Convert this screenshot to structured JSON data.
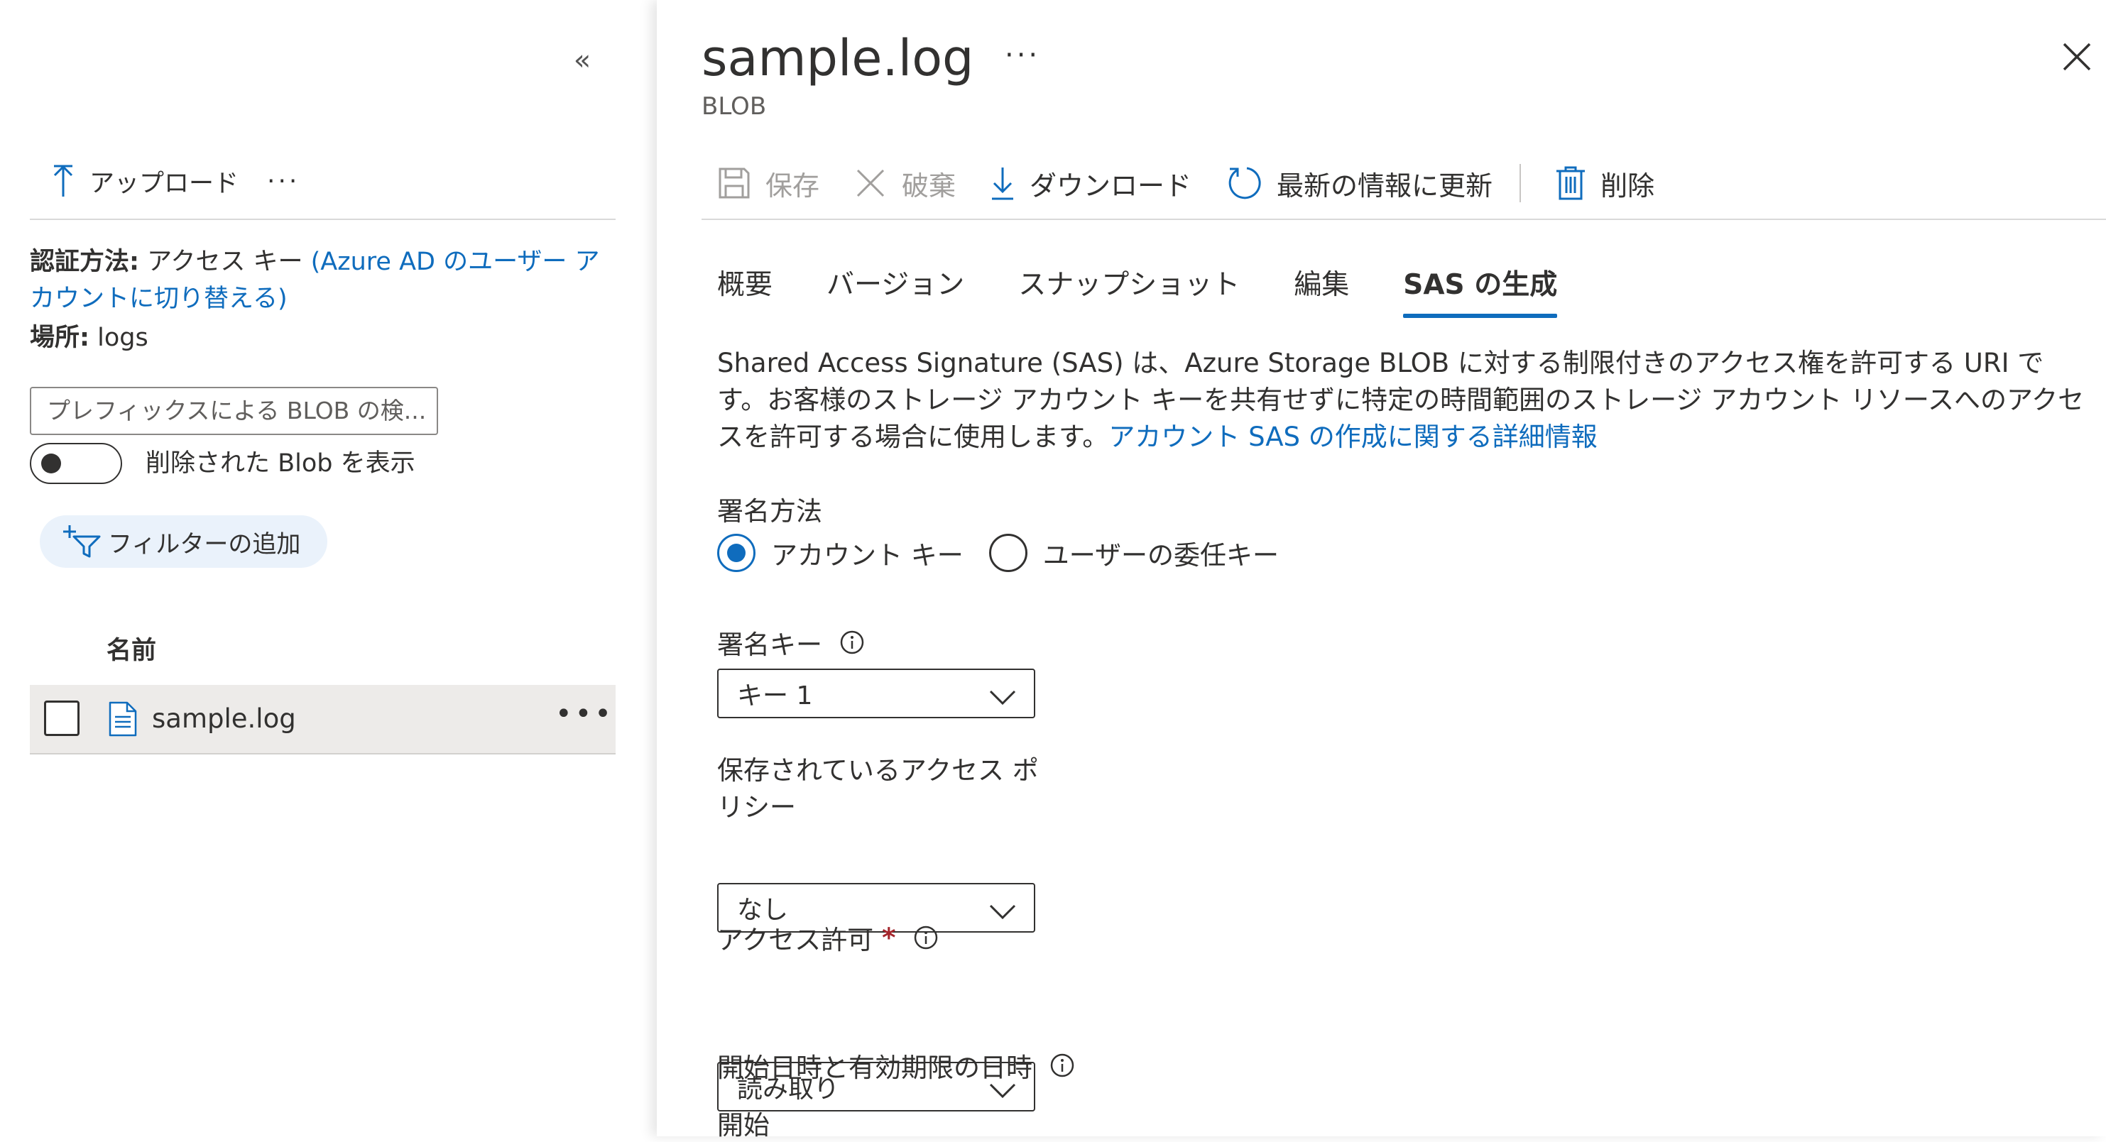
{
  "left_pane": {
    "upload_label": "アップロード",
    "more": "···",
    "auth_label": "認証方法:",
    "auth_value": " アクセス キー ",
    "auth_link": "(Azure AD のユーザー アカウントに切り替える)",
    "location_label": "場所:",
    "location_value": " logs",
    "search_placeholder": "プレフィックスによる BLOB の検...",
    "toggle_label": "削除された Blob を表示",
    "filter_label": "フィルターの追加",
    "column_name": "名前",
    "rows": [
      {
        "name": "sample.log"
      }
    ],
    "row_more": "•••"
  },
  "blade": {
    "title": "sample.log",
    "title_more": "···",
    "subtitle": "BLOB",
    "commands": {
      "save": "保存",
      "discard": "破棄",
      "download": "ダウンロード",
      "refresh": "最新の情報に更新",
      "delete": "削除"
    },
    "tabs": [
      "概要",
      "バージョン",
      "スナップショット",
      "編集",
      "SAS の生成"
    ],
    "active_tab": "SAS の生成",
    "description": "Shared Access Signature (SAS) は、Azure Storage BLOB に対する制限付きのアクセス権を許可する URI です。お客様のストレージ アカウント キーを共有せずに特定の時間範囲のストレージ アカウント リソースへのアクセスを許可する場合に使用します。",
    "description_link": "アカウント SAS の作成に関する詳細情報",
    "signing_method": {
      "label": "署名方法",
      "options": [
        "アカウント キー",
        "ユーザーの委任キー"
      ],
      "selected": "アカウント キー"
    },
    "signing_key": {
      "label": "署名キー",
      "value": "キー 1"
    },
    "stored_policy": {
      "label": "保存されているアクセス ポリシー",
      "value": "なし"
    },
    "permissions": {
      "label": "アクセス許可",
      "required_mark": "*",
      "value": "読み取り"
    },
    "dates_label": "開始日時と有効期限の日時",
    "start_label": "開始"
  },
  "colors": {
    "accent": "#0f6cbd",
    "text": "#323130",
    "disabled": "#a19f9d",
    "filter_pill": "#eaf2fb",
    "selected_row": "#edebe9"
  }
}
